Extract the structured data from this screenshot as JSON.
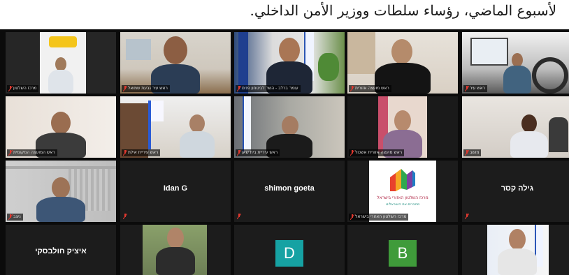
{
  "caption": "لأسبوع الماضي، رؤساء سلطات ووزير الأمن الداخلي.",
  "colors": {
    "active_speaker_border": "#67c52a",
    "muted_icon": "#e0382f",
    "tile_bg": "#1c1c1c",
    "grid_bg": "#0b0b0b",
    "avatar_D": "#16a2a3",
    "avatar_B": "#3f9b3a"
  },
  "tiles": [
    {
      "id": "r1c1",
      "type": "video",
      "name": "מרכז השלטון"
    },
    {
      "id": "r1c2",
      "type": "video",
      "name": "ראש עיר גבעת שמואל"
    },
    {
      "id": "r1c3",
      "type": "video",
      "name": "עומר ברלב - השר לביטחון פנים",
      "active": true
    },
    {
      "id": "r1c4",
      "type": "video",
      "name": "ראש מועצה אזורית"
    },
    {
      "id": "r1c5",
      "type": "video",
      "name": "ראש עיר"
    },
    {
      "id": "r2c1",
      "type": "video",
      "name": "ראש המועצה המקומית"
    },
    {
      "id": "r2c2",
      "type": "video",
      "name": "ראש עיריית אילת"
    },
    {
      "id": "r2c3",
      "type": "video",
      "name": "ראש עיריית בית שאן"
    },
    {
      "id": "r2c4",
      "type": "video",
      "name": "ראש מועצה אזורית אשכול"
    },
    {
      "id": "r2c5",
      "type": "video",
      "name": "מושב"
    },
    {
      "id": "r3c1",
      "type": "video",
      "name": "ניצב"
    },
    {
      "id": "r3c2",
      "type": "name",
      "name": "Idan G"
    },
    {
      "id": "r3c3",
      "type": "name",
      "name": "shimon goeta"
    },
    {
      "id": "r3c4",
      "type": "logo",
      "name": "מרכז השלטון האזורי בישראל",
      "logo_title": "מרכז השלטון האזורי בישראל",
      "logo_tagline": "מחברים את הישראלים"
    },
    {
      "id": "r3c5",
      "type": "name",
      "name": "גילה קסר"
    },
    {
      "id": "r4c1",
      "type": "name",
      "name": "איציק חולבסקי"
    },
    {
      "id": "r4c2",
      "type": "video",
      "name": ""
    },
    {
      "id": "r4c3",
      "type": "avatar",
      "name": "",
      "letter": "D"
    },
    {
      "id": "r4c4",
      "type": "avatar",
      "name": "",
      "letter": "B"
    },
    {
      "id": "r4c5",
      "type": "video",
      "name": ""
    }
  ]
}
